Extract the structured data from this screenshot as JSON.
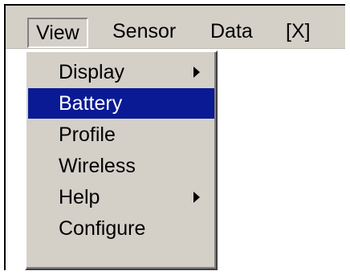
{
  "menubar": {
    "items": [
      {
        "label": "View"
      },
      {
        "label": "Sensor"
      },
      {
        "label": "Data"
      },
      {
        "label": "[X]"
      }
    ]
  },
  "view_menu": {
    "items": [
      {
        "label": "Display",
        "has_submenu": true,
        "selected": false
      },
      {
        "label": "Battery",
        "has_submenu": false,
        "selected": true
      },
      {
        "label": "Profile",
        "has_submenu": false,
        "selected": false
      },
      {
        "label": "Wireless",
        "has_submenu": false,
        "selected": false
      },
      {
        "label": "Help",
        "has_submenu": true,
        "selected": false
      },
      {
        "label": "Configure",
        "has_submenu": false,
        "selected": false
      }
    ]
  },
  "colors": {
    "menu_face": "#d4d0c8",
    "highlight": "#0a1a94",
    "highlight_text": "#ffffff"
  },
  "icons": {
    "submenu": "triangle-right-icon"
  }
}
